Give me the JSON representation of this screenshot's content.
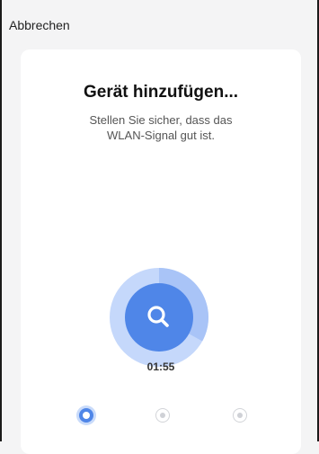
{
  "header": {
    "cancel_label": "Abbrechen"
  },
  "main": {
    "title": "Gerät hinzufügen...",
    "subtitle_line1": "Stellen Sie sicher, dass das",
    "subtitle_line2": "WLAN-Signal gut ist.",
    "timer": "01:55",
    "progress_fraction": 0.33,
    "search_icon": "search-icon"
  },
  "stepper": {
    "current_step": 1,
    "total_steps": 3
  },
  "colors": {
    "accent": "#4f86e8",
    "ring_light": "#c5d8fb",
    "ring_progress": "#a9c4f7",
    "background": "#f4f4f5",
    "card": "#ffffff"
  }
}
